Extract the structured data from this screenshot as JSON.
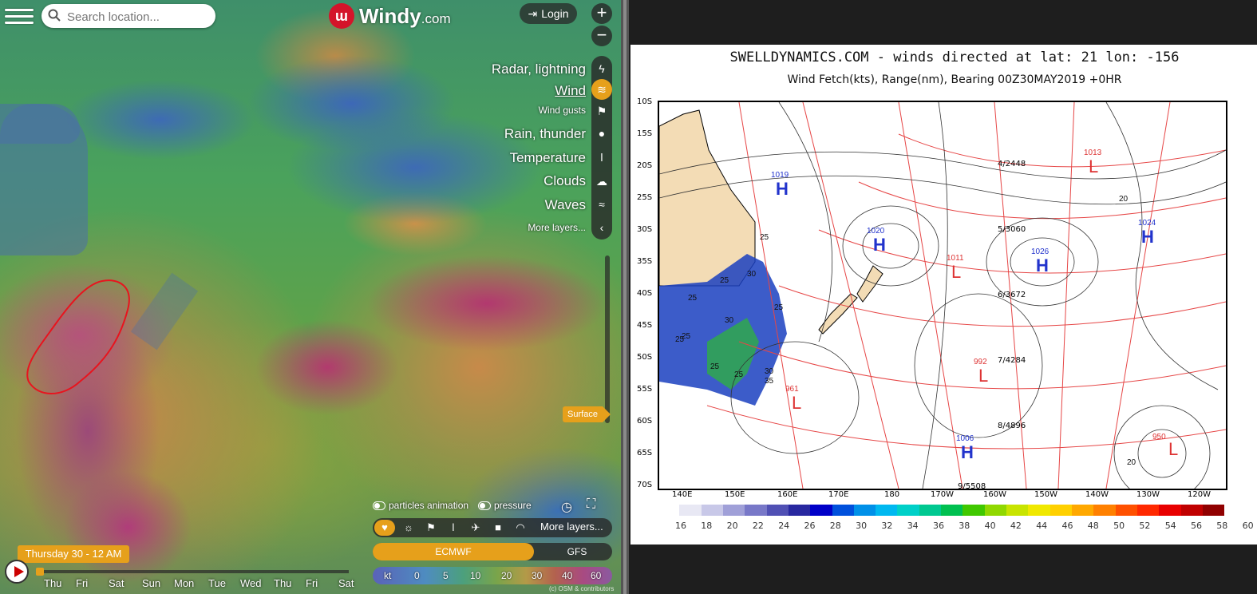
{
  "windy": {
    "search": {
      "placeholder": "Search location..."
    },
    "brand": {
      "name": "Windy",
      "tld": ".com"
    },
    "login_label": "Login",
    "zoom_in": "+",
    "zoom_out": "−",
    "layers": [
      {
        "label": "Radar, lightning",
        "icon": "radar-icon"
      },
      {
        "label": "Wind",
        "icon": "wind-icon",
        "active": true
      },
      {
        "label": "Wind gusts",
        "icon": "gust-flag-icon"
      },
      {
        "label": "Rain, thunder",
        "icon": "raindrop-icon"
      },
      {
        "label": "Temperature",
        "icon": "thermometer-icon"
      },
      {
        "label": "Clouds",
        "icon": "cloud-icon"
      },
      {
        "label": "Waves",
        "icon": "waves-icon"
      },
      {
        "label": "More layers...",
        "icon": "chevron-left-icon"
      }
    ],
    "altitude_label": "Surface",
    "options": {
      "particles": "particles animation",
      "pressure": "pressure"
    },
    "toolbar_more": "More layers...",
    "models": {
      "active": "ECMWF",
      "other": "GFS"
    },
    "scale": {
      "unit": "kt",
      "values": [
        "0",
        "5",
        "10",
        "20",
        "30",
        "40",
        "60"
      ]
    },
    "time_label": "Thursday 30 - 12 AM",
    "days": [
      "Thu",
      "Fri",
      "Sat",
      "Sun",
      "Mon",
      "Tue",
      "Wed",
      "Thu",
      "Fri",
      "Sat"
    ],
    "attribution": "(c) OSM & contributors",
    "accent": "#e6a01b"
  },
  "swell": {
    "title": "SWELLDYNAMICS.COM - winds directed at lat: 21 lon: -156",
    "subtitle": "Wind Fetch(kts), Range(nm), Bearing 00Z30MAY2019 +0HR",
    "lat_labels": [
      "10S",
      "15S",
      "20S",
      "25S",
      "30S",
      "35S",
      "40S",
      "45S",
      "50S",
      "55S",
      "60S",
      "65S",
      "70S"
    ],
    "lon_labels": [
      "140E",
      "150E",
      "160E",
      "170E",
      "180",
      "170W",
      "160W",
      "150W",
      "140W",
      "130W",
      "120W"
    ],
    "range_labels": [
      "4/2448",
      "5/3060",
      "6/3672",
      "7/4284",
      "8/4896",
      "9/5508"
    ],
    "pressure_centers": [
      {
        "type": "H",
        "value": "1019"
      },
      {
        "type": "H",
        "value": "1020"
      },
      {
        "type": "H",
        "value": "1026"
      },
      {
        "type": "H",
        "value": "1024"
      },
      {
        "type": "H",
        "value": "1006"
      },
      {
        "type": "L",
        "value": "1013"
      },
      {
        "type": "L",
        "value": "1011"
      },
      {
        "type": "L",
        "value": "992"
      },
      {
        "type": "L",
        "value": "961"
      },
      {
        "type": "L",
        "value": "950"
      }
    ],
    "fetch_labels": [
      "25",
      "30",
      "25",
      "25",
      "25",
      "30",
      "25",
      "25",
      "25",
      "30",
      "25",
      "35",
      "20",
      "20"
    ],
    "colorbar_ticks": [
      "16",
      "18",
      "20",
      "22",
      "24",
      "26",
      "28",
      "30",
      "32",
      "34",
      "36",
      "38",
      "40",
      "42",
      "44",
      "46",
      "48",
      "50",
      "52",
      "54",
      "56",
      "58",
      "60"
    ],
    "colorbar_colors": [
      "#ffffff",
      "#e8e8f4",
      "#c8c8e8",
      "#a0a0d8",
      "#7878c8",
      "#5050b4",
      "#2828a0",
      "#0000c8",
      "#0050dc",
      "#0090e8",
      "#00b8f0",
      "#00d0c8",
      "#00c890",
      "#00c050",
      "#40c800",
      "#90d800",
      "#c8e400",
      "#f0e800",
      "#ffd000",
      "#ffa800",
      "#ff8000",
      "#ff5000",
      "#ff2800",
      "#e80000",
      "#c00000",
      "#900000"
    ]
  }
}
